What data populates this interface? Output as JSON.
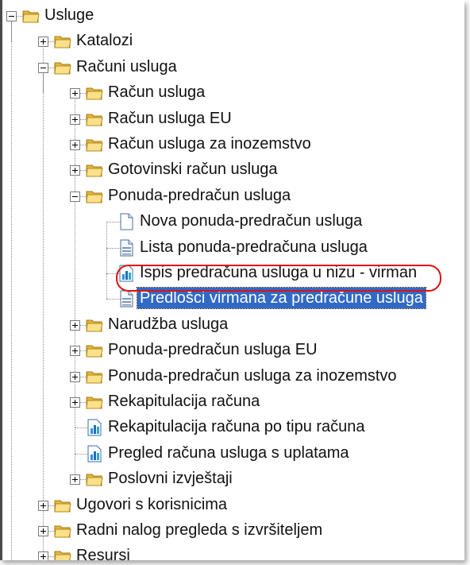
{
  "tree": [
    {
      "label": "Usluge",
      "type": "folder",
      "depth": 0,
      "expander": "minus"
    },
    {
      "label": "Katalozi",
      "type": "folder",
      "depth": 1,
      "expander": "plus"
    },
    {
      "label": "Računi usluga",
      "type": "folder",
      "depth": 1,
      "expander": "minus"
    },
    {
      "label": "Račun usluga",
      "type": "folder",
      "depth": 2,
      "expander": "plus"
    },
    {
      "label": "Račun usluga EU",
      "type": "folder",
      "depth": 2,
      "expander": "plus"
    },
    {
      "label": "Račun usluga za inozemstvo",
      "type": "folder",
      "depth": 2,
      "expander": "plus"
    },
    {
      "label": "Gotovinski račun usluga",
      "type": "folder",
      "depth": 2,
      "expander": "plus"
    },
    {
      "label": "Ponuda-predračun usluga",
      "type": "folder",
      "depth": 2,
      "expander": "minus"
    },
    {
      "label": "Nova ponuda-predračun usluga",
      "type": "doc-new",
      "depth": 3,
      "expander": "none"
    },
    {
      "label": "Lista ponuda-predračuna usluga",
      "type": "doc-list",
      "depth": 3,
      "expander": "none"
    },
    {
      "label": "Ispis predračuna usluga u nizu - virman",
      "type": "report",
      "depth": 3,
      "expander": "none",
      "highlighted": true
    },
    {
      "label": "Predlošci virmana za predračune usluga",
      "type": "doc-list",
      "depth": 3,
      "expander": "none",
      "selected": true
    },
    {
      "label": "Narudžba usluga",
      "type": "folder",
      "depth": 2,
      "expander": "plus"
    },
    {
      "label": "Ponuda-predračun usluga EU",
      "type": "folder",
      "depth": 2,
      "expander": "plus"
    },
    {
      "label": "Ponuda-predračun usluga za inozemstvo",
      "type": "folder",
      "depth": 2,
      "expander": "plus"
    },
    {
      "label": "Rekapitulacija računa",
      "type": "folder",
      "depth": 2,
      "expander": "plus"
    },
    {
      "label": "Rekapitulacija računa po tipu računa",
      "type": "report",
      "depth": 2,
      "expander": "none"
    },
    {
      "label": "Pregled računa usluga s uplatama",
      "type": "report",
      "depth": 2,
      "expander": "none"
    },
    {
      "label": "Poslovni izvještaji",
      "type": "folder",
      "depth": 2,
      "expander": "plus"
    },
    {
      "label": "Ugovori s korisnicima",
      "type": "folder",
      "depth": 1,
      "expander": "plus"
    },
    {
      "label": "Radni nalog pregleda s izvršiteljem",
      "type": "folder",
      "depth": 1,
      "expander": "plus"
    },
    {
      "label": "Resursi",
      "type": "folder",
      "depth": 1,
      "expander": "plus"
    }
  ],
  "colors": {
    "selection_bg": "#316ac5",
    "highlight_ring": "#e01010",
    "folder_yellow": "#f7d77a"
  },
  "icons": {
    "folder": "folder-icon",
    "doc-new": "new-document-icon",
    "doc-list": "list-document-icon",
    "report": "report-chart-icon"
  }
}
